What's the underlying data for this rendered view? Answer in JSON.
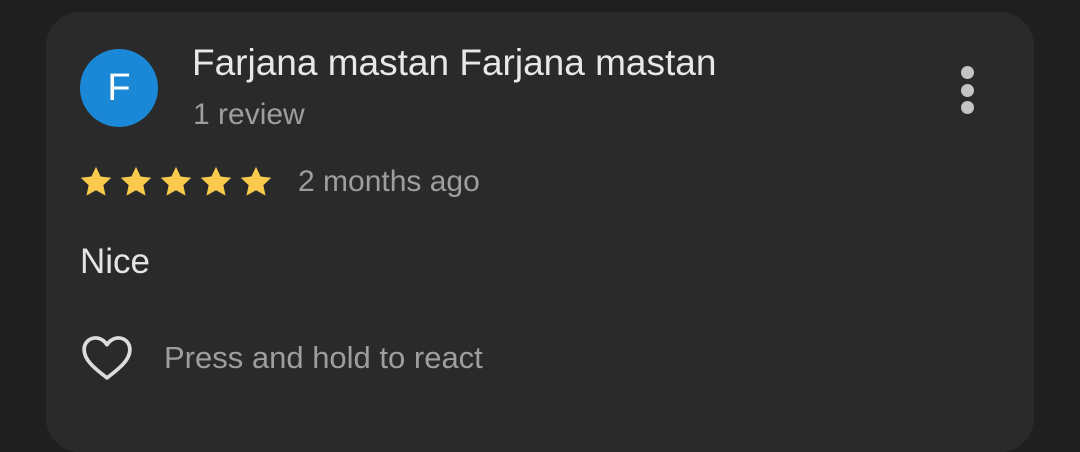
{
  "review": {
    "author_initial": "F",
    "author_name": "Farjana mastan Farjana mastan",
    "review_count_label": "1 review",
    "rating": 5,
    "rating_max": 5,
    "date_label": "2 months ago",
    "text": "Nice",
    "react_label": "Press and hold to react"
  },
  "colors": {
    "avatar_bg": "#1a88d6",
    "star_fill": "#f8c94a"
  },
  "icons": {
    "menu": "more-vert-icon",
    "star": "star-icon",
    "react": "heart-outline-icon"
  }
}
